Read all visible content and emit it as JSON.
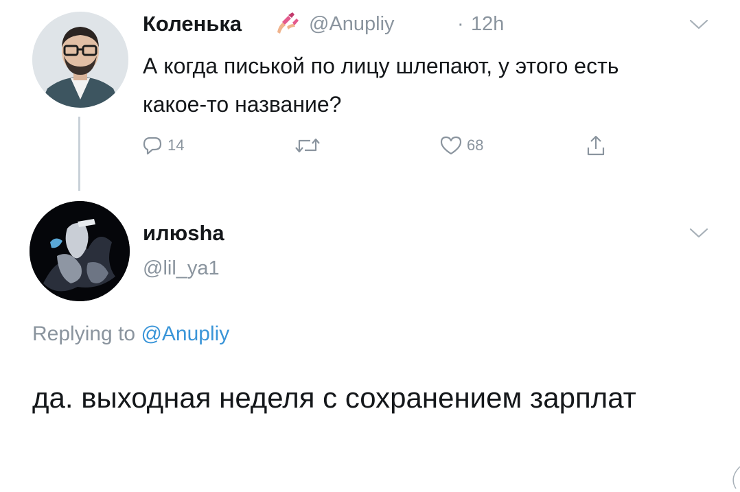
{
  "tweet": {
    "author_name": "Коленька",
    "author_emoji": "nail-polish-emoji",
    "handle": "@Anupliy",
    "separator": "·",
    "time": "12h",
    "text": "А когда писькой по лицу шлепают, у этого есть какое-то название?",
    "actions": {
      "reply_count": "14",
      "like_count": "68"
    }
  },
  "reply": {
    "author_name": "илюsha",
    "handle": "@lil_ya1",
    "replying_prefix": "Replying to",
    "replying_to": "@Anupliy",
    "text": "да. выходная неделя с сохранением зарплат"
  },
  "colors": {
    "text": "#14171a",
    "secondary": "#8a949e",
    "link": "#3a95d8",
    "thread_line": "#c9d1d8"
  },
  "icons": [
    "chevron-down-icon",
    "reply-icon",
    "retweet-icon",
    "like-icon",
    "share-icon"
  ]
}
